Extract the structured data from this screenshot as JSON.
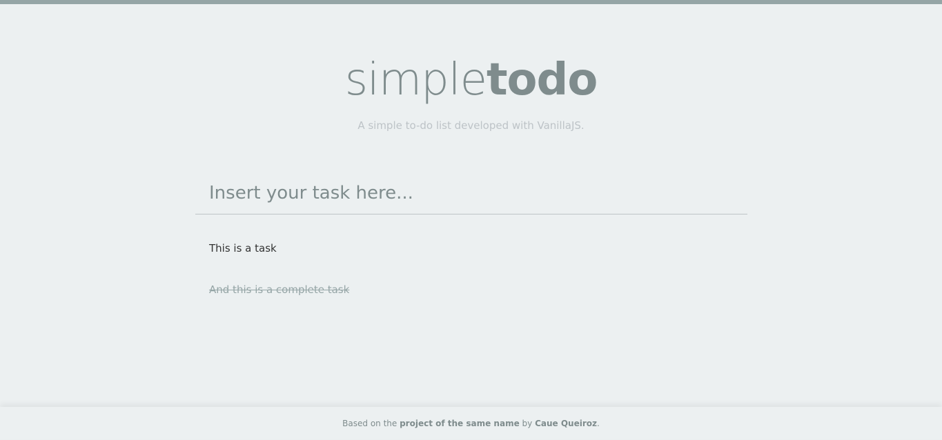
{
  "colors": {
    "background": "#ecf0f1",
    "top_bar": "#95a5a6",
    "logo": "#7f8c8d",
    "subtitle": "#bdc3c7",
    "task_text": "#333333",
    "completed_task_text": "#95a5a6"
  },
  "header": {
    "logo_light": "simple",
    "logo_bold": "todo",
    "subtitle": "A simple to-do list developed with VanillaJS."
  },
  "input": {
    "placeholder": "Insert your task here...",
    "value": ""
  },
  "tasks": [
    {
      "text": "This is a task",
      "completed": false
    },
    {
      "text": "And this is a complete task",
      "completed": true
    }
  ],
  "footer": {
    "prefix": "Based on the ",
    "project_link": "project of the same name",
    "middle": " by ",
    "author_link": "Caue Queiroz",
    "suffix": "."
  }
}
